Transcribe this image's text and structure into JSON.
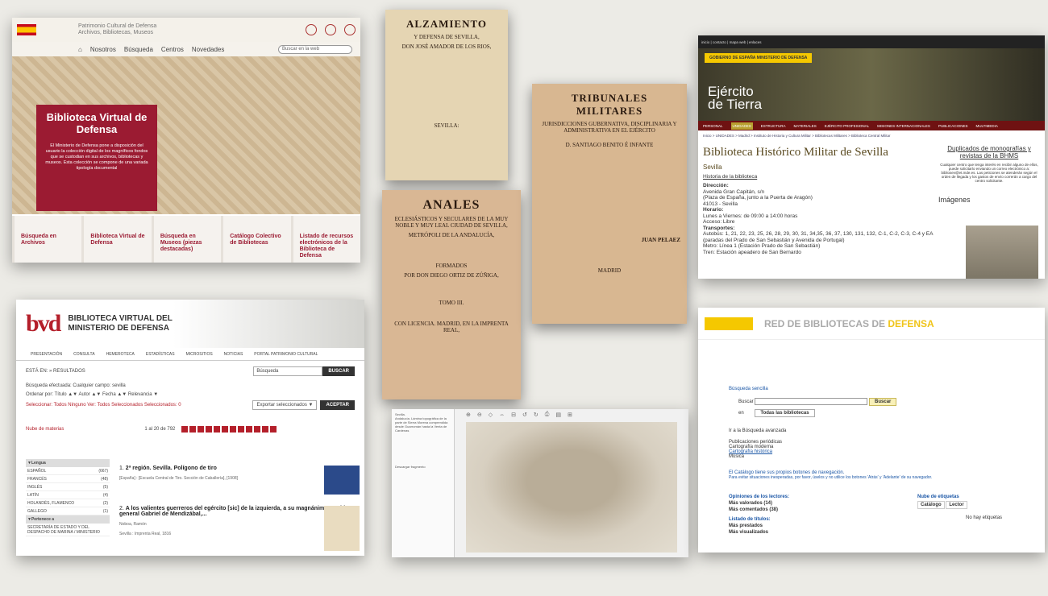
{
  "bvd": {
    "header_title_1": "Patrimonio Cultural de Defensa",
    "header_title_2": "Archivos, Bibliotecas, Museos",
    "nav": [
      "Nosotros",
      "Búsqueda",
      "Centros",
      "Novedades"
    ],
    "search_placeholder": "Buscar en la web",
    "hero_title": "Biblioteca Virtual de Defensa",
    "hero_text": "El Ministerio de Defensa pone a disposición del usuario la colección digital de los magníficos fondos que se custodian en sus archivos, bibliotecas y museos. Esta colección se compone de una variada tipología documental",
    "tiles": [
      "Búsqueda en Archivos",
      "Biblioteca Virtual de Defensa",
      "Búsqueda en Museos (piezas destacadas)",
      "Catálogo Colectivo de Bibliotecas",
      "Listado de recursos electrónicos de la Biblioteca de Defensa"
    ]
  },
  "bvmd": {
    "logo": "bvd",
    "brand_1": "BIBLIOTECA VIRTUAL DEL",
    "brand_2": "MINISTERIO DE DEFENSA",
    "menu": [
      "PRESENTACIÓN",
      "CONSULTA",
      "HEMEROTECA",
      "ESTADÍSTICAS",
      "MICROSITIOS",
      "NOTICIAS",
      "PORTAL PATRIMONIO CULTURAL"
    ],
    "breadcrumb": "ESTÁ EN:  » RESULTADOS",
    "search_placeholder": "Búsqueda",
    "search_button": "BUSCAR",
    "search_done": "Búsqueda efectuada: Cualquier campo: sevilla",
    "order_by": "Ordenar por: Título ▲▼   Autor ▲▼   Fecha ▲▼   Relevancia ▼",
    "select": "Seleccionar: Todos Ninguno   Ver: Todos Seleccionados   Seleccionados: 0",
    "export": "Exportar seleccionados ▼",
    "accept": "ACEPTAR",
    "tag_cloud": "Nube de materias",
    "pagination": "1 al 20 de 792",
    "facet_lang": "▼Lengua",
    "facets": [
      {
        "name": "ESPAÑOL",
        "count": "(667)"
      },
      {
        "name": "FRANCÉS",
        "count": "(48)"
      },
      {
        "name": "INGLÉS",
        "count": "(5)"
      },
      {
        "name": "LATÍN",
        "count": "(4)"
      },
      {
        "name": "HOLANDÉS, FLAMENCO",
        "count": "(2)"
      },
      {
        "name": "GALLEGO",
        "count": "(1)"
      }
    ],
    "facet_belongs": "▼Pertenece a",
    "facet_belongs_item": "SECRETARÍA DE ESTADO Y DEL DESPACHO DE MARINA / MINISTERIO",
    "results": [
      {
        "n": "1.",
        "title": "2ª región. Sevilla. Polígono de tiro",
        "meta": "[España] : [Escuela Central de Tiro. Sección de Caballería], [1908]"
      },
      {
        "n": "2.",
        "title": "A los valientes guerreros del egército [sic] de la izquierda, a su magnánimo y sabio general Gabriel de Mendizábal,...",
        "meta": "Noboa, Ramón",
        "meta2": "Sevilla : Imprenta Real, 1816"
      }
    ]
  },
  "books": {
    "b1_title": "ALZAMIENTO",
    "b1_sub": "Y DEFENSA DE SEVILLA,",
    "b1_author": "DON JOSÉ AMADOR DE LOS RIOS,",
    "b1_place": "SEVILLA:",
    "b2_title": "ANALES",
    "b2_sub": "ECLESIÁSTICOS Y SECULARES DE LA MUY NOBLE Y MUY LEAL CIUDAD DE SEVILLA,",
    "b2_sub2": "METRÓPOLI DE LA ANDALUCÍA,",
    "b2_formed": "FORMADOS",
    "b2_author": "POR DON DIEGO ORTIZ DE ZÚÑIGA,",
    "b2_foot": "CON LICENCIA. MADRID, EN LA IMPRENTA REAL,",
    "b2_tomo": "TOMO III.",
    "b3_title": "TRIBUNALES MILITARES",
    "b3_sub": "JURISDICCIONES GUBERNATIVA, DISCIPLINARIA Y ADMINISTRATIVA EN EL EJÉRCITO",
    "b3_author": "D. SANTIAGO BENITO É INFANTE",
    "b3_stamp": "JUAN PELAEZ",
    "b3_foot": "MADRID"
  },
  "map": {
    "side_title": "Sevilla.",
    "side_text": "Andalucía. Lámina topográfica de la parte de Sierra Morena comprendida desde Guarromán hasta la Venta de Cardenas",
    "side_link": "Descargar fragmento",
    "toolbar": [
      "⊕",
      "⊖",
      "◇",
      "⇔",
      "⊟",
      "↺",
      "↻",
      "⎙",
      "▤",
      "⊞"
    ]
  },
  "ejercito": {
    "topbar": "inicio | contacto | mapa web | enlaces",
    "gov": "GOBIERNO DE ESPAÑA   MINISTERIO DE DEFENSA",
    "brand_1": "Ejército",
    "brand_2": "de Tierra",
    "menu": [
      "PERSONAL",
      "UNIDADES",
      "ESTRUCTURA",
      "MATERIALES",
      "EJÉRCITO PROFESIONAL",
      "MISIONES INTERNACIONALES",
      "PUBLICACIONES",
      "MULTIMEDIA"
    ],
    "breadcrumb": "Inicio > UNIDADES > Madrid > Instituto de Historia y Cultura Militar > Bibliotecas Militares > Biblioteca Central Militar",
    "title": "Biblioteca Histórico Militar de Sevilla",
    "city": "Sevilla",
    "history": "Historia de la biblioteca",
    "addr_h": "Dirección:",
    "addr_1": "Avenida Gran Capitán, s/n",
    "addr_2": "(Plaza de España, junto a la Puerta de Aragón)",
    "addr_3": "41013 - Sevilla",
    "hours_h": "Horario:",
    "hours": "Lunes a Viernes: de 09:00 a 14:00 horas",
    "access": "Acceso: Libre",
    "transport_h": "Transportes:",
    "transport_1": "Autobús: 1, 21, 22, 23, 25, 26, 28, 29, 30, 31, 34,35, 36, 37, 130, 131, 132, C-1, C-2, C-3, C-4 y EA",
    "transport_2": "(paradas del Prado de San Sebastián y Avenida de Portugal)",
    "transport_3": "Metro: Línea 1 (Estación Prado de San Sebastián)",
    "transport_4": "Tren: Estación apeadero de San Bernardo",
    "right_title": "Duplicados de monografías y revistas de la BHMS",
    "right_text": "Cualquier centro que tenga interés en recibir alguno de ellos, puede solicitarlo enviando un correo electrónico a: bibliosev@et.mde.es. Las peticiones se atenderán según el orden de llegada y los gastos de envío correrán a cargo del centro solicitante.",
    "images": "Imágenes"
  },
  "red": {
    "title_1": "RED DE BIBLIOTECAS DE",
    "title_2": "DEFENSA",
    "simple": "Búsqueda sencilla",
    "buscar_label": "Buscar",
    "buscar_btn": "Buscar",
    "en": "en",
    "all": "Todas las bibliotecas",
    "advanced": "Ir a la Búsqueda avanzada",
    "list": [
      "Publicaciones periódicas",
      "Cartografía moderna",
      "Cartografía histórica",
      "Música"
    ],
    "nav_note": "El Catálogo tiene sus propios botones de navegación.",
    "nav_note2": "Para evitar situaciones inesperadas, por favor, úselos y no utilice los botones 'Atrás' y 'Adelante' de su navegador.",
    "opinions": "Opiniones de los lectores:",
    "top_rated": "Más valorados (14)",
    "top_commented": "Más comentados (38)",
    "titles": "Listado de títulos:",
    "most_lent": "Más prestados",
    "most_viewed": "Más visualizados",
    "tags": "Nube de etiquetas",
    "tab_1": "Catálogo",
    "tab_2": "Lector",
    "no_tags": "No hay etiquetas"
  }
}
